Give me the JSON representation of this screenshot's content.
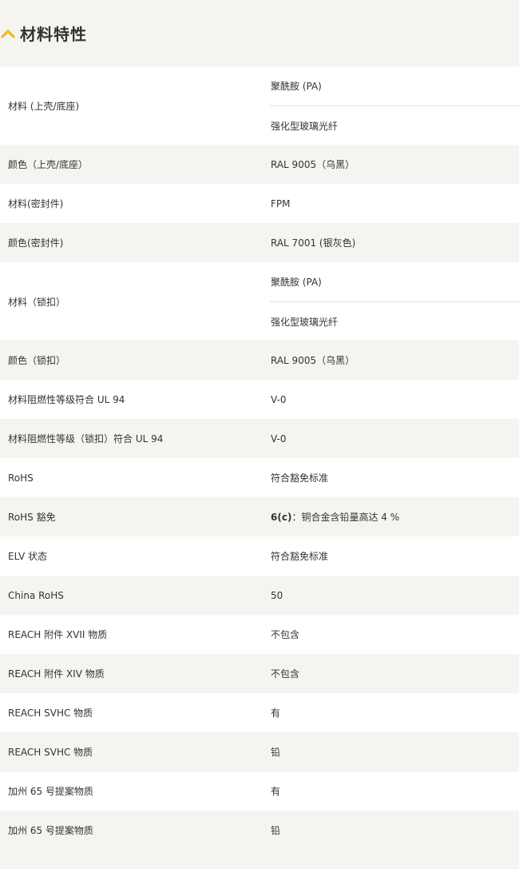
{
  "section": {
    "title": "材料特性",
    "icon": "chevron-up-icon",
    "accent_color": "#f0b81c"
  },
  "rows": [
    {
      "label": "材料 (上壳/底座)",
      "values": [
        "聚酰胺 (PA)",
        "强化型玻璃光纤"
      ]
    },
    {
      "label": "颜色（上壳/底座）",
      "values": [
        "RAL 9005（乌黑）"
      ]
    },
    {
      "label": "材料(密封件)",
      "values": [
        "FPM"
      ]
    },
    {
      "label": "颜色(密封件)",
      "values": [
        "RAL 7001 (银灰色)"
      ]
    },
    {
      "label": "材料（锁扣）",
      "values": [
        "聚酰胺 (PA)",
        "强化型玻璃光纤"
      ]
    },
    {
      "label": "颜色（锁扣）",
      "values": [
        "RAL 9005（乌黑）"
      ]
    },
    {
      "label": "材料阻燃性等级符合 UL 94",
      "values": [
        "V-0"
      ]
    },
    {
      "label": "材料阻燃性等级（锁扣）符合 UL 94",
      "values": [
        "V-0"
      ]
    },
    {
      "label": "RoHS",
      "values": [
        "符合豁免标准"
      ]
    },
    {
      "label": "RoHS 豁免",
      "values": [
        "6(c)：铜合金含铅量高达 4 %"
      ],
      "bold_prefix": "6(c)",
      "rest": "：铜合金含铅量高达 4 %"
    },
    {
      "label": "ELV 状态",
      "values": [
        "符合豁免标准"
      ]
    },
    {
      "label": "China RoHS",
      "values": [
        "50"
      ]
    },
    {
      "label": "REACH 附件 XVII 物质",
      "values": [
        "不包含"
      ]
    },
    {
      "label": "REACH 附件 XIV 物质",
      "values": [
        "不包含"
      ]
    },
    {
      "label": "REACH SVHC 物质",
      "values": [
        "有"
      ]
    },
    {
      "label": "REACH SVHC 物质",
      "values": [
        "铅"
      ]
    },
    {
      "label": "加州 65 号提案物质",
      "values": [
        "有"
      ]
    },
    {
      "label": "加州 65 号提案物质",
      "values": [
        "铅"
      ]
    }
  ]
}
